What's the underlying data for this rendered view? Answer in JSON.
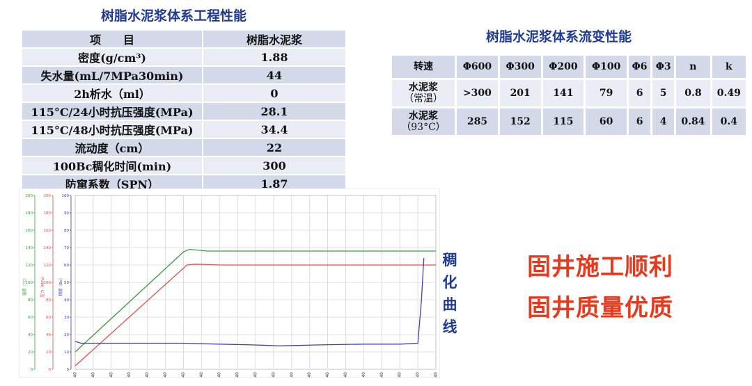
{
  "left_title": "树脂水泥浆体系工程性能",
  "right_title": "树脂水泥浆体系流变性能",
  "performance_table": {
    "header": [
      "项　　目",
      "树脂水泥浆"
    ],
    "rows": [
      {
        "label": "密度(g/cm³)",
        "value": "1.88"
      },
      {
        "label": "失水量(mL/7MPa30min)",
        "value": "44"
      },
      {
        "label": "2h析水（ml）",
        "value": "0"
      },
      {
        "label": "115°C/24小时抗压强度(MPa)",
        "value": "28.1"
      },
      {
        "label": "115°C/48小时抗压强度(MPa)",
        "value": "34.4"
      },
      {
        "label": "流动度（cm）",
        "value": "22"
      },
      {
        "label": "100Bc稠化时间(min)",
        "value": "300"
      },
      {
        "label": "防窜系数（SPN）",
        "value": "1.87"
      }
    ]
  },
  "rheology_table": {
    "header": [
      "转速",
      "Φ600",
      "Φ300",
      "Φ200",
      "Φ100",
      "Φ6",
      "Φ3",
      "n",
      "k"
    ],
    "rows": [
      {
        "label_line1": "水泥浆",
        "label_line2": "（常温）",
        "values": [
          ">300",
          "201",
          "141",
          "79",
          "6",
          "5",
          "0.8",
          "0.49"
        ]
      },
      {
        "label_line1": "水泥浆",
        "label_line2": "（93°C）",
        "values": [
          "285",
          "152",
          "115",
          "60",
          "6",
          "4",
          "0.84",
          "0.4"
        ]
      }
    ]
  },
  "chart_caption": [
    "稠",
    "化",
    "曲",
    "线"
  ],
  "slogans": [
    "固井施工顺利",
    "固井质量优质"
  ],
  "chart_data": {
    "type": "line",
    "x_ticks": [
      "00:00:40",
      "00:15:40",
      "00:30:40",
      "00:45:40",
      "01:00:40",
      "01:15:40",
      "01:30:40",
      "01:45:40",
      "02:00:40",
      "02:15:40",
      "02:30:40",
      "02:45:40",
      "03:00:40",
      "03:15:40",
      "03:30:40",
      "03:45:40",
      "04:00:40",
      "04:15:40",
      "04:30:40",
      "04:45:40",
      "05:00:40"
    ],
    "x_range_min": [
      0,
      300
    ],
    "axes": [
      {
        "label": "温度（°C）",
        "color": "#3c9a3c",
        "ticks": [
          0,
          20,
          40,
          60,
          80,
          100,
          120,
          140,
          160,
          180,
          200
        ]
      },
      {
        "label": "压力（MPa）",
        "color": "#d9534f",
        "ticks": [
          0,
          20,
          40,
          60,
          80,
          100,
          120,
          140,
          160,
          180,
          200
        ]
      },
      {
        "label": "稠度（Bc）",
        "color": "#3a3aa8",
        "ticks": [
          0,
          10,
          20,
          30,
          40,
          50,
          60,
          70,
          80,
          90,
          100
        ]
      }
    ],
    "series": [
      {
        "axis": 0,
        "color": "#3c9a3c",
        "x": [
          0,
          90,
          95,
          110,
          150,
          250,
          300
        ],
        "y": [
          20,
          135,
          138,
          136,
          136,
          136,
          136
        ]
      },
      {
        "axis": 1,
        "color": "#d9534f",
        "x": [
          0,
          93,
          100,
          120,
          200,
          300
        ],
        "y": [
          4,
          120,
          121,
          120,
          120,
          120
        ]
      },
      {
        "axis": 2,
        "color": "#4040b8",
        "x": [
          0,
          5,
          30,
          60,
          90,
          120,
          150,
          170,
          200,
          240,
          270,
          285,
          288,
          290
        ],
        "y": [
          16,
          15,
          15,
          15,
          15,
          14.5,
          14,
          13.5,
          14,
          14.5,
          14.5,
          15,
          40,
          64
        ]
      }
    ]
  }
}
